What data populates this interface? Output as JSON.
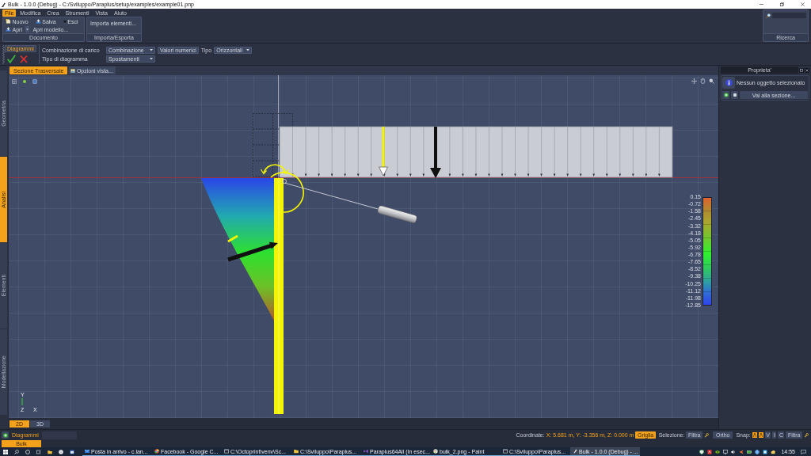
{
  "window": {
    "title": "Bulk - 1.0.0 (Debug) - C:/Sviluppo/Paraplus/setup/examples/example01.pnp"
  },
  "menu": [
    {
      "label": "File",
      "selected": true
    },
    {
      "label": "Modifica",
      "selected": false
    },
    {
      "label": "Crea",
      "selected": false
    },
    {
      "label": "Strumenti",
      "selected": false
    },
    {
      "label": "Vista",
      "selected": false
    },
    {
      "label": "Aiuto",
      "selected": false
    }
  ],
  "ribbon": {
    "document": {
      "title": "Documento",
      "rows": [
        [
          {
            "label": "Nuovo",
            "kind": "new"
          },
          {
            "label": "Salva",
            "kind": "save"
          },
          {
            "label": "Esci",
            "kind": "exit"
          }
        ],
        [
          {
            "label": "Apri",
            "kind": "open"
          },
          {
            "label": "Apri modello...",
            "kind": "plain"
          }
        ]
      ]
    },
    "import_export": {
      "title": "Importa/Esporta",
      "buttons": [
        "Importa elementi..."
      ]
    },
    "search": {
      "title": "Ricerca"
    }
  },
  "diagram_toolbar": {
    "title": "Diagrammi",
    "load_combination": {
      "label": "Combinazione di carico",
      "value": "Combinazione"
    },
    "numeric_values_button": "Valori numerici",
    "type": {
      "label": "Tipo",
      "value": "Orizzontali"
    },
    "diagram_type": {
      "label": "Tipo di diagramma",
      "value": "Spostamenti"
    }
  },
  "side_tabs": [
    {
      "label": "Geometria",
      "selected": false
    },
    {
      "label": "Analisi",
      "selected": true
    },
    {
      "label": "Elementi",
      "selected": false
    },
    {
      "label": "Modellazione",
      "selected": false
    }
  ],
  "view_tabs": [
    {
      "label": "Sezione Trasversale",
      "selected": true
    }
  ],
  "view_options_button": "Opzioni vista...",
  "legend": {
    "labels": [
      "0.15",
      "-0.72",
      "-1.58",
      "-2.45",
      "-3.32",
      "-4.18",
      "-5.05",
      "-5.92",
      "-6.78",
      "-7.65",
      "-8.52",
      "-9.38",
      "-10.25",
      "-11.12",
      "-11.98",
      "-12.85"
    ]
  },
  "axes": {
    "y": "Y",
    "z": "Z",
    "x": "X"
  },
  "view_mode_tabs": [
    {
      "label": "2D",
      "selected": true
    },
    {
      "label": "3D",
      "selected": false
    }
  ],
  "properties": {
    "title": "Proprieta'",
    "message": "Nessun oggetto selezionato",
    "goto_button": "Vai alla sezione..."
  },
  "bottom_panel": {
    "title": "Diagrammi"
  },
  "document_tabs": [
    {
      "label": "Bulk",
      "selected": true
    }
  ],
  "status_bar": {
    "coordinates_label": "Coordinate:",
    "coordinates": "X: 5.681 m, Y: -3.356 m, Z: 0.000 m",
    "grid": {
      "label": "Griglia",
      "on": true
    },
    "selection_label": "Selezione:",
    "selection_filter": "Filtra",
    "ortho": {
      "label": "Ortho",
      "on": false
    },
    "snap_label": "Snap:",
    "snap_toggles": [
      {
        "kind": "icon",
        "on": true
      },
      {
        "kind": "icon",
        "on": true
      },
      {
        "kind": "letter",
        "label": "V",
        "on": false
      },
      {
        "kind": "letter",
        "label": "I",
        "on": false
      },
      {
        "kind": "letter",
        "label": "C",
        "on": false
      }
    ],
    "snap_filter": "Filtra"
  },
  "taskbar": {
    "items": [
      {
        "label": "Posta in arrivo - c.lan...",
        "kind": "mail",
        "selected": false
      },
      {
        "label": "Facebook - Google C...",
        "kind": "browser",
        "selected": false
      },
      {
        "label": "C:\\Octoprint\\venv\\Sc...",
        "kind": "console",
        "selected": false
      },
      {
        "label": "C:\\Sviluppo\\Paraplus...",
        "kind": "folder",
        "selected": false
      },
      {
        "label": "Paraplus64All (In esec...",
        "kind": "studio",
        "selected": false
      },
      {
        "label": "bulk_2.png - Paint",
        "kind": "paint",
        "selected": false
      },
      {
        "label": "C:\\Sviluppo\\Paraplus...",
        "kind": "console",
        "selected": false
      },
      {
        "label": "Bulk - 1.0.0 (Debug) - ...",
        "kind": "app",
        "selected": true
      }
    ],
    "time": "14:55"
  }
}
